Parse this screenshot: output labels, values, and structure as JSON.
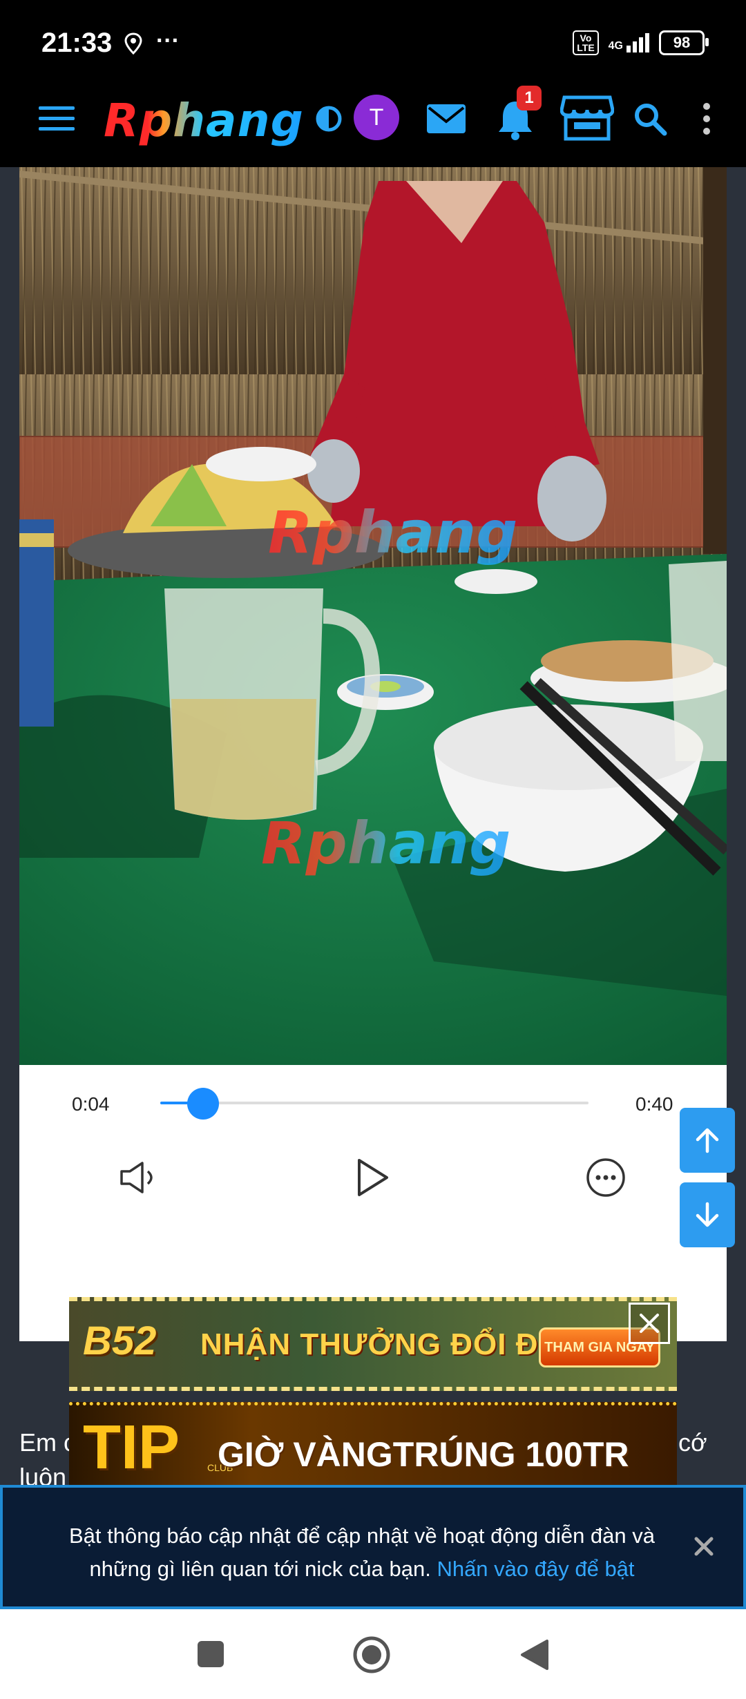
{
  "status_bar": {
    "time": "21:33",
    "more": "···",
    "volte_label": "Vo\nLTE",
    "network": "4G",
    "battery": "98"
  },
  "header": {
    "logo": "Rphang",
    "avatar_letter": "T",
    "notification_count": "1",
    "accent_color": "#2ba6f5"
  },
  "video": {
    "watermark": "Rphang",
    "current_time": "0:04",
    "duration": "0:40",
    "progress_fraction": 0.1
  },
  "article": {
    "text_start": "Em c",
    "text_end": "cớ",
    "line2_start": "luôn"
  },
  "ads": {
    "ad1_brand": "B52",
    "ad1_text": "NHẬN THƯỞNG ĐỔI ĐỜI",
    "ad1_cta": "THAM GIA NGAY",
    "ad2_brand": "TIP",
    "ad2_club": "CLUB",
    "ad2_text": "GIỜ VÀNGTRÚNG 100TR"
  },
  "banner": {
    "text": "Bật thông báo cập nhật để cập nhật về hoạt động diễn đàn và những gì liên quan tới nick của bạn.",
    "link": "Nhấn vào đây để bật"
  }
}
